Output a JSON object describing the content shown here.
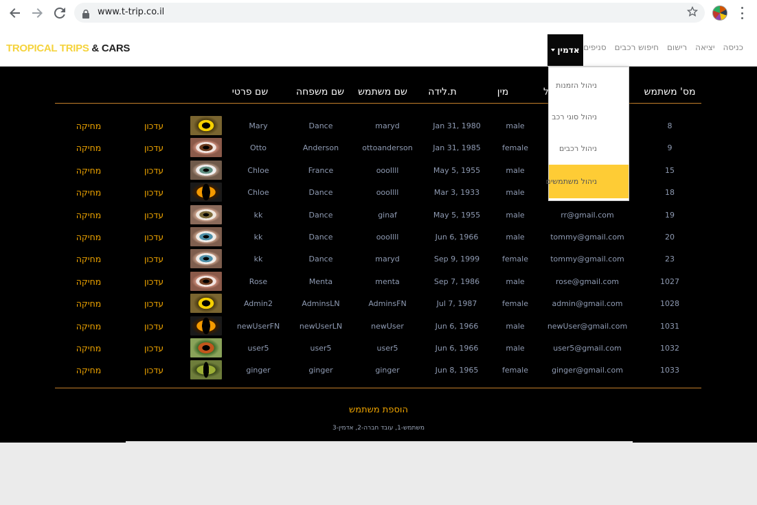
{
  "browser": {
    "url": "www.t-trip.co.il",
    "back_icon": "arrow-left-icon",
    "forward_icon": "arrow-right-icon",
    "reload_icon": "reload-icon",
    "lock_icon": "lock-icon",
    "star_icon": "star-icon",
    "menu_icon": "kebab-menu-icon"
  },
  "site": {
    "brand_part1": "TROPICAL TRIPS",
    "brand_part2": " & CARS",
    "nav": {
      "login": "כניסה",
      "logout": "יציאה",
      "register": "רישום",
      "car_search": "חיפוש רכבים",
      "branches": "סניפים",
      "admin": "אדמין"
    },
    "colors": {
      "accent": "#f0a500",
      "brand_yellow": "#f5d33c",
      "active_item": "#fecc35",
      "panel": "#000000"
    }
  },
  "dropdown": {
    "items": [
      "ניהול הזמנות",
      "ניהול סוגי רכב",
      "ניהול רכבים",
      "ניהול משתמשים"
    ],
    "active_index": 3
  },
  "table": {
    "headers": {
      "user_no": "מס' משתמש",
      "email_partial": "ל",
      "gender": "מין",
      "birth": "ת.לידה",
      "username": "שם משתמש",
      "last_name": "שם משפחה",
      "first_name": "שם פרטי"
    },
    "edit_label": "עדכון",
    "delete_label": "מחיקה",
    "rows": [
      {
        "id": "8",
        "email": "",
        "gender": "male",
        "birth": "Jan 31, 1980",
        "username": "maryd",
        "last": "Dance",
        "first": "Mary",
        "eye": "yellow"
      },
      {
        "id": "9",
        "email": "",
        "gender": "female",
        "birth": "Jan 31, 1985",
        "username": "ottoanderson",
        "last": "Anderson",
        "first": "Otto",
        "eye": "brown"
      },
      {
        "id": "15",
        "email": "",
        "gender": "male",
        "birth": "May 5, 1955",
        "username": "oooIlll",
        "last": "France",
        "first": "Chloe",
        "eye": "green"
      },
      {
        "id": "18",
        "email": "",
        "gender": "male",
        "birth": "Mar 3, 1933",
        "username": "oooIlll",
        "last": "Dance",
        "first": "Chloe",
        "eye": "cat"
      },
      {
        "id": "19",
        "email": "rr@gmail.com",
        "gender": "male",
        "birth": "May 5, 1955",
        "username": "ginaf",
        "last": "Dance",
        "first": "kk",
        "eye": "hazel"
      },
      {
        "id": "20",
        "email": "tommy@gmail.com",
        "gender": "male",
        "birth": "Jun 6, 1966",
        "username": "oooIlll",
        "last": "Dance",
        "first": "kk",
        "eye": "blue"
      },
      {
        "id": "23",
        "email": "tommy@gmail.com",
        "gender": "female",
        "birth": "Sep 9, 1999",
        "username": "maryd",
        "last": "Dance",
        "first": "kk",
        "eye": "blue"
      },
      {
        "id": "1027",
        "email": "rose@gmail.com",
        "gender": "male",
        "birth": "Sep 7, 1986",
        "username": "menta",
        "last": "Menta",
        "first": "Rose",
        "eye": "brown"
      },
      {
        "id": "1028",
        "email": "admin@gmail.com",
        "gender": "female",
        "birth": "Jul 7, 1987",
        "username": "AdminsFN",
        "last": "AdminsLN",
        "first": "Admin2",
        "eye": "yellow"
      },
      {
        "id": "1031",
        "email": "newUser@gmail.com",
        "gender": "male",
        "birth": "Jun 6, 1966",
        "username": "newUser",
        "last": "newUserLN",
        "first": "newUserFN",
        "eye": "cat"
      },
      {
        "id": "1032",
        "email": "user5@gmail.com",
        "gender": "male",
        "birth": "Jun 6, 1966",
        "username": "user5",
        "last": "user5",
        "first": "user5",
        "eye": "reptile"
      },
      {
        "id": "1033",
        "email": "ginger@gmail.com",
        "gender": "female",
        "birth": "Jun 8, 1965",
        "username": "ginger",
        "last": "ginger",
        "first": "ginger",
        "eye": "snake"
      }
    ]
  },
  "add_user_label": "הוספת משתמש",
  "role_legend": "משתמש-1, עובד חברה-2, אדמין-3"
}
